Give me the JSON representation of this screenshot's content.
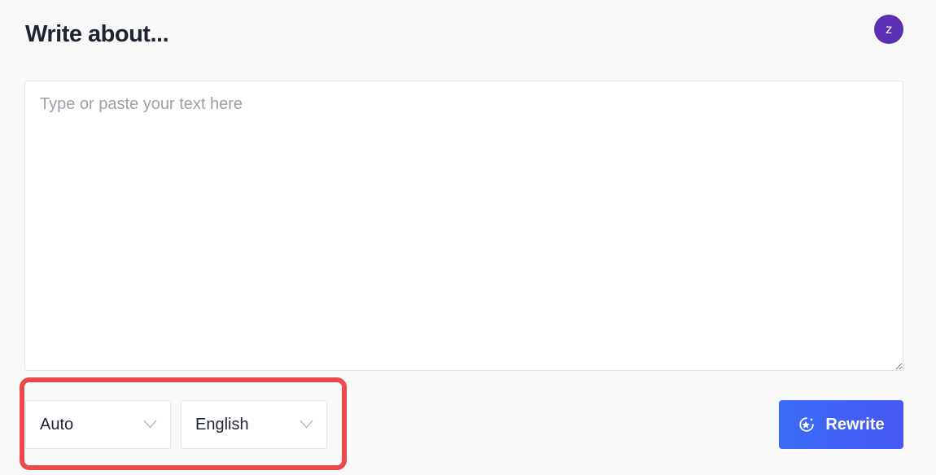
{
  "header": {
    "title": "Write about...",
    "avatar_initial": "z"
  },
  "editor": {
    "placeholder": "Type or paste your text here",
    "value": ""
  },
  "controls": {
    "tone_select": {
      "selected": "Auto",
      "icon": "chevron-down-icon"
    },
    "language_select": {
      "selected": "English",
      "icon": "chevron-down-icon"
    },
    "rewrite_button": {
      "label": "Rewrite",
      "icon": "sparkle-icon"
    }
  },
  "colors": {
    "background": "#f9f9f9",
    "avatar": "#5b2fb3",
    "button_gradient_start": "#3a6cf6",
    "button_gradient_end": "#4758f4",
    "highlight_border": "#ea4a4a"
  }
}
